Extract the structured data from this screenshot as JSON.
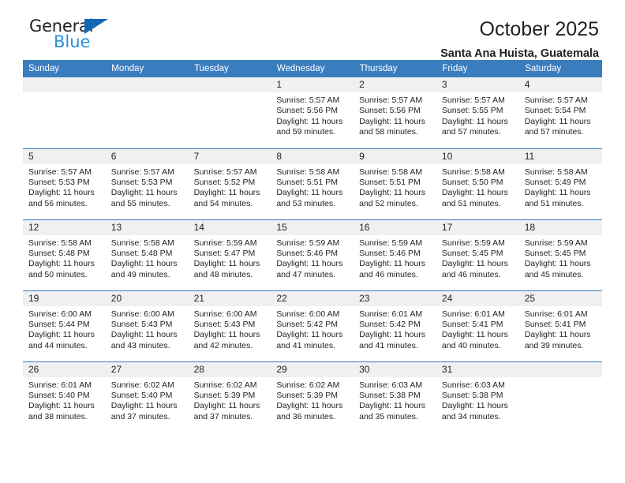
{
  "brand": {
    "word1": "General",
    "word2": "Blue"
  },
  "header": {
    "title": "October 2025",
    "subtitle": "Santa Ana Huista, Guatemala",
    "accent_color": "#3a7dbf",
    "daynum_bg": "#f0f0f0"
  },
  "weekdays": [
    "Sunday",
    "Monday",
    "Tuesday",
    "Wednesday",
    "Thursday",
    "Friday",
    "Saturday"
  ],
  "weeks": [
    [
      {
        "day": "",
        "blank": true,
        "sunrise": "",
        "sunset": "",
        "daylight1": "",
        "daylight2": ""
      },
      {
        "day": "",
        "blank": true,
        "sunrise": "",
        "sunset": "",
        "daylight1": "",
        "daylight2": ""
      },
      {
        "day": "",
        "blank": true,
        "sunrise": "",
        "sunset": "",
        "daylight1": "",
        "daylight2": ""
      },
      {
        "day": "1",
        "sunrise": "Sunrise: 5:57 AM",
        "sunset": "Sunset: 5:56 PM",
        "daylight1": "Daylight: 11 hours",
        "daylight2": "and 59 minutes."
      },
      {
        "day": "2",
        "sunrise": "Sunrise: 5:57 AM",
        "sunset": "Sunset: 5:56 PM",
        "daylight1": "Daylight: 11 hours",
        "daylight2": "and 58 minutes."
      },
      {
        "day": "3",
        "sunrise": "Sunrise: 5:57 AM",
        "sunset": "Sunset: 5:55 PM",
        "daylight1": "Daylight: 11 hours",
        "daylight2": "and 57 minutes."
      },
      {
        "day": "4",
        "sunrise": "Sunrise: 5:57 AM",
        "sunset": "Sunset: 5:54 PM",
        "daylight1": "Daylight: 11 hours",
        "daylight2": "and 57 minutes."
      }
    ],
    [
      {
        "day": "5",
        "sunrise": "Sunrise: 5:57 AM",
        "sunset": "Sunset: 5:53 PM",
        "daylight1": "Daylight: 11 hours",
        "daylight2": "and 56 minutes."
      },
      {
        "day": "6",
        "sunrise": "Sunrise: 5:57 AM",
        "sunset": "Sunset: 5:53 PM",
        "daylight1": "Daylight: 11 hours",
        "daylight2": "and 55 minutes."
      },
      {
        "day": "7",
        "sunrise": "Sunrise: 5:57 AM",
        "sunset": "Sunset: 5:52 PM",
        "daylight1": "Daylight: 11 hours",
        "daylight2": "and 54 minutes."
      },
      {
        "day": "8",
        "sunrise": "Sunrise: 5:58 AM",
        "sunset": "Sunset: 5:51 PM",
        "daylight1": "Daylight: 11 hours",
        "daylight2": "and 53 minutes."
      },
      {
        "day": "9",
        "sunrise": "Sunrise: 5:58 AM",
        "sunset": "Sunset: 5:51 PM",
        "daylight1": "Daylight: 11 hours",
        "daylight2": "and 52 minutes."
      },
      {
        "day": "10",
        "sunrise": "Sunrise: 5:58 AM",
        "sunset": "Sunset: 5:50 PM",
        "daylight1": "Daylight: 11 hours",
        "daylight2": "and 51 minutes."
      },
      {
        "day": "11",
        "sunrise": "Sunrise: 5:58 AM",
        "sunset": "Sunset: 5:49 PM",
        "daylight1": "Daylight: 11 hours",
        "daylight2": "and 51 minutes."
      }
    ],
    [
      {
        "day": "12",
        "sunrise": "Sunrise: 5:58 AM",
        "sunset": "Sunset: 5:48 PM",
        "daylight1": "Daylight: 11 hours",
        "daylight2": "and 50 minutes."
      },
      {
        "day": "13",
        "sunrise": "Sunrise: 5:58 AM",
        "sunset": "Sunset: 5:48 PM",
        "daylight1": "Daylight: 11 hours",
        "daylight2": "and 49 minutes."
      },
      {
        "day": "14",
        "sunrise": "Sunrise: 5:59 AM",
        "sunset": "Sunset: 5:47 PM",
        "daylight1": "Daylight: 11 hours",
        "daylight2": "and 48 minutes."
      },
      {
        "day": "15",
        "sunrise": "Sunrise: 5:59 AM",
        "sunset": "Sunset: 5:46 PM",
        "daylight1": "Daylight: 11 hours",
        "daylight2": "and 47 minutes."
      },
      {
        "day": "16",
        "sunrise": "Sunrise: 5:59 AM",
        "sunset": "Sunset: 5:46 PM",
        "daylight1": "Daylight: 11 hours",
        "daylight2": "and 46 minutes."
      },
      {
        "day": "17",
        "sunrise": "Sunrise: 5:59 AM",
        "sunset": "Sunset: 5:45 PM",
        "daylight1": "Daylight: 11 hours",
        "daylight2": "and 46 minutes."
      },
      {
        "day": "18",
        "sunrise": "Sunrise: 5:59 AM",
        "sunset": "Sunset: 5:45 PM",
        "daylight1": "Daylight: 11 hours",
        "daylight2": "and 45 minutes."
      }
    ],
    [
      {
        "day": "19",
        "sunrise": "Sunrise: 6:00 AM",
        "sunset": "Sunset: 5:44 PM",
        "daylight1": "Daylight: 11 hours",
        "daylight2": "and 44 minutes."
      },
      {
        "day": "20",
        "sunrise": "Sunrise: 6:00 AM",
        "sunset": "Sunset: 5:43 PM",
        "daylight1": "Daylight: 11 hours",
        "daylight2": "and 43 minutes."
      },
      {
        "day": "21",
        "sunrise": "Sunrise: 6:00 AM",
        "sunset": "Sunset: 5:43 PM",
        "daylight1": "Daylight: 11 hours",
        "daylight2": "and 42 minutes."
      },
      {
        "day": "22",
        "sunrise": "Sunrise: 6:00 AM",
        "sunset": "Sunset: 5:42 PM",
        "daylight1": "Daylight: 11 hours",
        "daylight2": "and 41 minutes."
      },
      {
        "day": "23",
        "sunrise": "Sunrise: 6:01 AM",
        "sunset": "Sunset: 5:42 PM",
        "daylight1": "Daylight: 11 hours",
        "daylight2": "and 41 minutes."
      },
      {
        "day": "24",
        "sunrise": "Sunrise: 6:01 AM",
        "sunset": "Sunset: 5:41 PM",
        "daylight1": "Daylight: 11 hours",
        "daylight2": "and 40 minutes."
      },
      {
        "day": "25",
        "sunrise": "Sunrise: 6:01 AM",
        "sunset": "Sunset: 5:41 PM",
        "daylight1": "Daylight: 11 hours",
        "daylight2": "and 39 minutes."
      }
    ],
    [
      {
        "day": "26",
        "sunrise": "Sunrise: 6:01 AM",
        "sunset": "Sunset: 5:40 PM",
        "daylight1": "Daylight: 11 hours",
        "daylight2": "and 38 minutes."
      },
      {
        "day": "27",
        "sunrise": "Sunrise: 6:02 AM",
        "sunset": "Sunset: 5:40 PM",
        "daylight1": "Daylight: 11 hours",
        "daylight2": "and 37 minutes."
      },
      {
        "day": "28",
        "sunrise": "Sunrise: 6:02 AM",
        "sunset": "Sunset: 5:39 PM",
        "daylight1": "Daylight: 11 hours",
        "daylight2": "and 37 minutes."
      },
      {
        "day": "29",
        "sunrise": "Sunrise: 6:02 AM",
        "sunset": "Sunset: 5:39 PM",
        "daylight1": "Daylight: 11 hours",
        "daylight2": "and 36 minutes."
      },
      {
        "day": "30",
        "sunrise": "Sunrise: 6:03 AM",
        "sunset": "Sunset: 5:38 PM",
        "daylight1": "Daylight: 11 hours",
        "daylight2": "and 35 minutes."
      },
      {
        "day": "31",
        "sunrise": "Sunrise: 6:03 AM",
        "sunset": "Sunset: 5:38 PM",
        "daylight1": "Daylight: 11 hours",
        "daylight2": "and 34 minutes."
      },
      {
        "day": "",
        "blank": true,
        "sunrise": "",
        "sunset": "",
        "daylight1": "",
        "daylight2": ""
      }
    ]
  ]
}
